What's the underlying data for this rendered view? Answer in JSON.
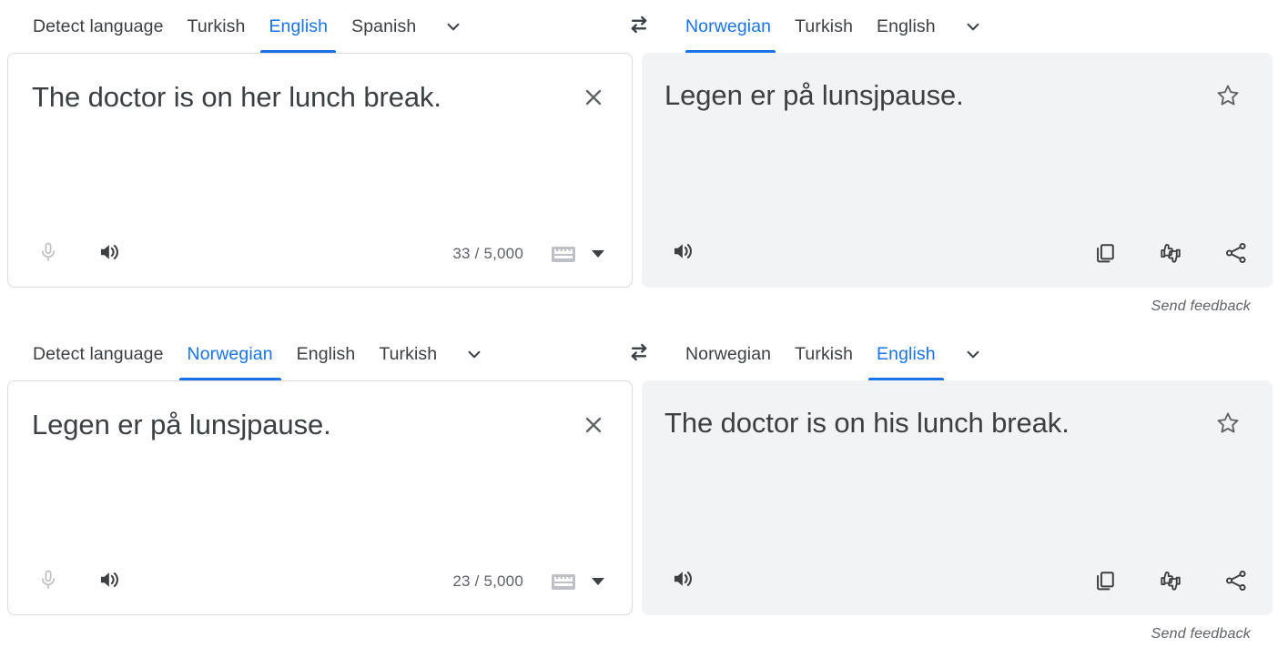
{
  "accent_color": "#1a73e8",
  "text_color": "#3c4043",
  "muted_color": "#5f6368",
  "panel_bg": "#f1f3f4",
  "blocks": [
    {
      "source": {
        "tabs": [
          {
            "label": "Detect language",
            "active": false
          },
          {
            "label": "Turkish",
            "active": false
          },
          {
            "label": "English",
            "active": true
          },
          {
            "label": "Spanish",
            "active": false
          }
        ],
        "more_icon": "chevron-down-icon",
        "text": "The doctor is on her lunch break.",
        "clear_icon": "close-icon",
        "mic_icon": "microphone-icon",
        "speaker_icon": "speaker-icon",
        "char_count": "33 / 5,000",
        "keyboard_icon": "keyboard-icon",
        "keyboard_caret_icon": "caret-down-icon"
      },
      "swap_icon": "swap-languages-icon",
      "target": {
        "tabs": [
          {
            "label": "Norwegian",
            "active": true
          },
          {
            "label": "Turkish",
            "active": false
          },
          {
            "label": "English",
            "active": false
          }
        ],
        "more_icon": "chevron-down-icon",
        "text": "Legen er på lunsjpause.",
        "star_icon": "star-outline-icon",
        "speaker_icon": "speaker-icon",
        "copy_icon": "copy-icon",
        "feedback_icon": "thumbs-up-down-icon",
        "share_icon": "share-icon"
      },
      "send_feedback": "Send feedback"
    },
    {
      "source": {
        "tabs": [
          {
            "label": "Detect language",
            "active": false
          },
          {
            "label": "Norwegian",
            "active": true
          },
          {
            "label": "English",
            "active": false
          },
          {
            "label": "Turkish",
            "active": false
          }
        ],
        "more_icon": "chevron-down-icon",
        "text": "Legen er på lunsjpause.",
        "clear_icon": "close-icon",
        "mic_icon": "microphone-icon",
        "speaker_icon": "speaker-icon",
        "char_count": "23 / 5,000",
        "keyboard_icon": "keyboard-icon",
        "keyboard_caret_icon": "caret-down-icon"
      },
      "swap_icon": "swap-languages-icon",
      "target": {
        "tabs": [
          {
            "label": "Norwegian",
            "active": false
          },
          {
            "label": "Turkish",
            "active": false
          },
          {
            "label": "English",
            "active": true
          }
        ],
        "more_icon": "chevron-down-icon",
        "text": "The doctor is on his lunch break.",
        "star_icon": "star-outline-icon",
        "speaker_icon": "speaker-icon",
        "copy_icon": "copy-icon",
        "feedback_icon": "thumbs-up-down-icon",
        "share_icon": "share-icon"
      },
      "send_feedback": "Send feedback"
    }
  ]
}
